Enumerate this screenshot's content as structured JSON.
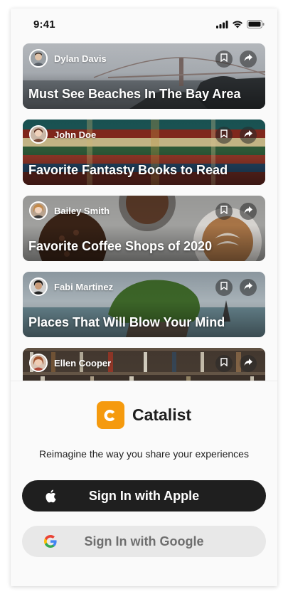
{
  "status_bar": {
    "time": "9:41"
  },
  "cards": [
    {
      "author": "Dylan Davis",
      "title": "Must See Beaches In The Bay Area",
      "scene": "bridge-fog-photo"
    },
    {
      "author": "John Doe",
      "title": "Favorite Fantasty Books to Read",
      "scene": "book-stack-photo"
    },
    {
      "author": "Bailey Smith",
      "title": "Favorite Coffee Shops of 2020",
      "scene": "coffee-beans-photo"
    },
    {
      "author": "Fabi Martinez",
      "title": "Places That Will Blow Your Mind",
      "scene": "rock-island-photo"
    },
    {
      "author": "Ellen Cooper",
      "title": "",
      "scene": "bookshelf-photo"
    }
  ],
  "brand": {
    "name": "Catalist",
    "accent": "#f59a0e"
  },
  "tagline": "Reimagine the way you share your experiences",
  "buttons": {
    "apple": "Sign In with Apple",
    "google": "Sign In with Google"
  }
}
